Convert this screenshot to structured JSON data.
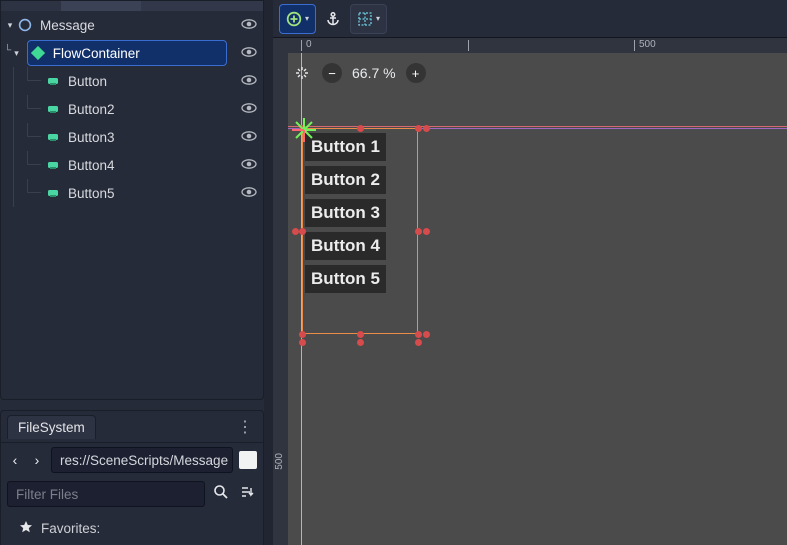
{
  "scene_tree": {
    "root": {
      "name": "Message"
    },
    "selected": {
      "name": "FlowContainer"
    },
    "children": [
      {
        "name": "Button"
      },
      {
        "name": "Button2"
      },
      {
        "name": "Button3"
      },
      {
        "name": "Button4"
      },
      {
        "name": "Button5"
      }
    ]
  },
  "filesystem": {
    "tab": "FileSystem",
    "path": "res://SceneScripts/Message",
    "filter_placeholder": "Filter Files",
    "favorites_label": "Favorites:"
  },
  "viewport": {
    "zoom_label": "66.7 %",
    "ruler": {
      "h0": "0",
      "h500": "500",
      "v500": "500"
    },
    "buttons": [
      "Button 1",
      "Button 2",
      "Button 3",
      "Button 4",
      "Button 5"
    ]
  },
  "icons": {
    "add": "add-icon",
    "anchor": "anchor-icon",
    "grid": "grid-snap-icon"
  }
}
